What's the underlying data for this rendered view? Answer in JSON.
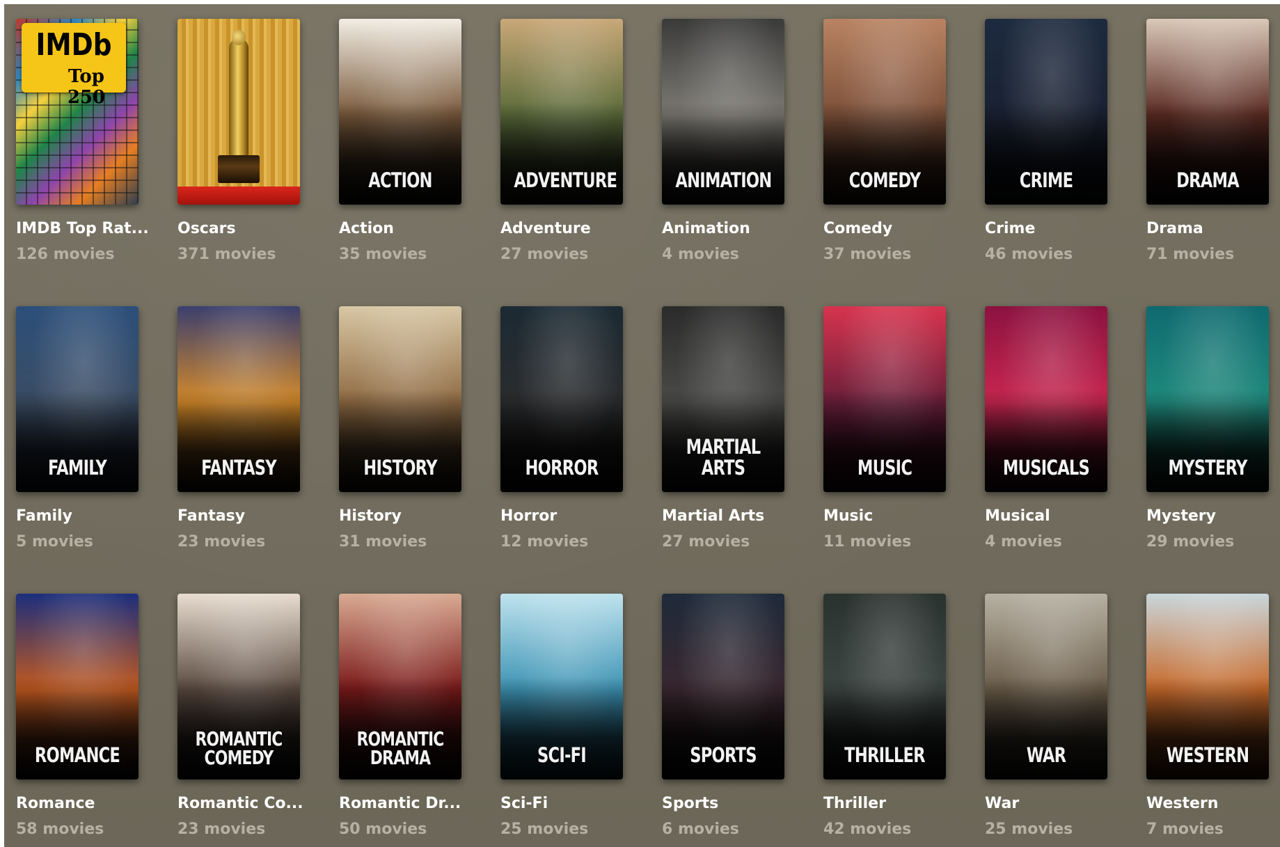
{
  "categories": [
    {
      "name": "IMDB Top Rat...",
      "count": "126 movies",
      "poster": {
        "kind": "imdb",
        "logo": "IMDb",
        "sub": "Top 250"
      }
    },
    {
      "name": "Oscars",
      "count": "371 movies",
      "poster": {
        "kind": "oscar"
      }
    },
    {
      "name": "Action",
      "count": "35 movies",
      "poster": {
        "kind": "genre",
        "title": "ACTION",
        "top": "#f2ede4",
        "mid": "#7a5a3c",
        "bottom": "#0d0c0b"
      }
    },
    {
      "name": "Adventure",
      "count": "27 movies",
      "poster": {
        "kind": "genre",
        "title": "ADVENTURE",
        "top": "#c9a878",
        "mid": "#5b6b3a",
        "bottom": "#111210"
      }
    },
    {
      "name": "Animation",
      "count": "4 movies",
      "poster": {
        "kind": "genre",
        "title": "ANIMATION",
        "top": "#3a3a3a",
        "mid": "#7d7a73",
        "bottom": "#0c0c0c"
      }
    },
    {
      "name": "Comedy",
      "count": "37 movies",
      "poster": {
        "kind": "genre",
        "title": "COMEDY",
        "top": "#b98363",
        "mid": "#7c5039",
        "bottom": "#1a100a"
      }
    },
    {
      "name": "Crime",
      "count": "46 movies",
      "poster": {
        "kind": "genre",
        "title": "CRIME",
        "top": "#1d2a3f",
        "mid": "#1a2233",
        "bottom": "#080a0f"
      }
    },
    {
      "name": "Drama",
      "count": "71 movies",
      "poster": {
        "kind": "genre",
        "title": "DRAMA",
        "top": "#d9c8b8",
        "mid": "#5b2b22",
        "bottom": "#0c0606"
      }
    },
    {
      "name": "Family",
      "count": "5 movies",
      "poster": {
        "kind": "genre",
        "title": "FAMILY",
        "top": "#2c4f7a",
        "mid": "#3b4c63",
        "bottom": "#0c1118"
      }
    },
    {
      "name": "Fantasy",
      "count": "23 movies",
      "poster": {
        "kind": "genre",
        "title": "FANTASY",
        "top": "#3b3f6e",
        "mid": "#d48a2a",
        "bottom": "#120b05"
      }
    },
    {
      "name": "History",
      "count": "31 movies",
      "poster": {
        "kind": "genre",
        "title": "HISTORY",
        "top": "#d8c7a5",
        "mid": "#8f6b43",
        "bottom": "#1a120b"
      }
    },
    {
      "name": "Horror",
      "count": "12 movies",
      "poster": {
        "kind": "genre",
        "title": "HORROR",
        "top": "#1c2a33",
        "mid": "#2b2c2e",
        "bottom": "#060606"
      }
    },
    {
      "name": "Martial Arts",
      "count": "27 movies",
      "poster": {
        "kind": "genre",
        "title": "MARTIAL ARTS",
        "top": "#2b2b2b",
        "mid": "#4a4a48",
        "bottom": "#080808"
      }
    },
    {
      "name": "Music",
      "count": "11 movies",
      "poster": {
        "kind": "genre",
        "title": "MUSIC",
        "top": "#d8344e",
        "mid": "#6a1e3a",
        "bottom": "#14060d"
      }
    },
    {
      "name": "Musical",
      "count": "4 movies",
      "poster": {
        "kind": "genre",
        "title": "MUSICALS",
        "top": "#8c1240",
        "mid": "#c8264f",
        "bottom": "#18050c"
      }
    },
    {
      "name": "Mystery",
      "count": "29 movies",
      "poster": {
        "kind": "genre",
        "title": "MYSTERY",
        "top": "#0f6a6f",
        "mid": "#1f8a7d",
        "bottom": "#07130f"
      }
    },
    {
      "name": "Romance",
      "count": "58 movies",
      "poster": {
        "kind": "genre",
        "title": "ROMANCE",
        "top": "#1c2f7d",
        "mid": "#c35a1f",
        "bottom": "#07060c"
      }
    },
    {
      "name": "Romantic Co...",
      "count": "23 movies",
      "poster": {
        "kind": "genre",
        "title": "ROMANTIC COMEDY",
        "top": "#e8ddd0",
        "mid": "#5a4a40",
        "bottom": "#0b0b0b"
      }
    },
    {
      "name": "Romantic Dr...",
      "count": "50 movies",
      "poster": {
        "kind": "genre",
        "title": "ROMANTIC DRAMA",
        "top": "#d9aa92",
        "mid": "#7a1a1a",
        "bottom": "#0d0606"
      }
    },
    {
      "name": "Sci-Fi",
      "count": "25 movies",
      "poster": {
        "kind": "genre",
        "title": "SCI-FI",
        "top": "#bfe3ee",
        "mid": "#3d93b4",
        "bottom": "#0c2733"
      }
    },
    {
      "name": "Sports",
      "count": "6 movies",
      "poster": {
        "kind": "genre",
        "title": "SPORTS",
        "top": "#1e2a3a",
        "mid": "#3a2830",
        "bottom": "#080808"
      }
    },
    {
      "name": "Thriller",
      "count": "42 movies",
      "poster": {
        "kind": "genre",
        "title": "THRILLER",
        "top": "#2a3230",
        "mid": "#3c4542",
        "bottom": "#0a0c0b"
      }
    },
    {
      "name": "War",
      "count": "25 movies",
      "poster": {
        "kind": "genre",
        "title": "WAR",
        "top": "#b7b1a3",
        "mid": "#6a5c49",
        "bottom": "#151210"
      }
    },
    {
      "name": "Western",
      "count": "7 movies",
      "poster": {
        "kind": "genre",
        "title": "WESTERN",
        "top": "#c9d6dc",
        "mid": "#c86a2a",
        "bottom": "#3a1a0a"
      }
    }
  ]
}
